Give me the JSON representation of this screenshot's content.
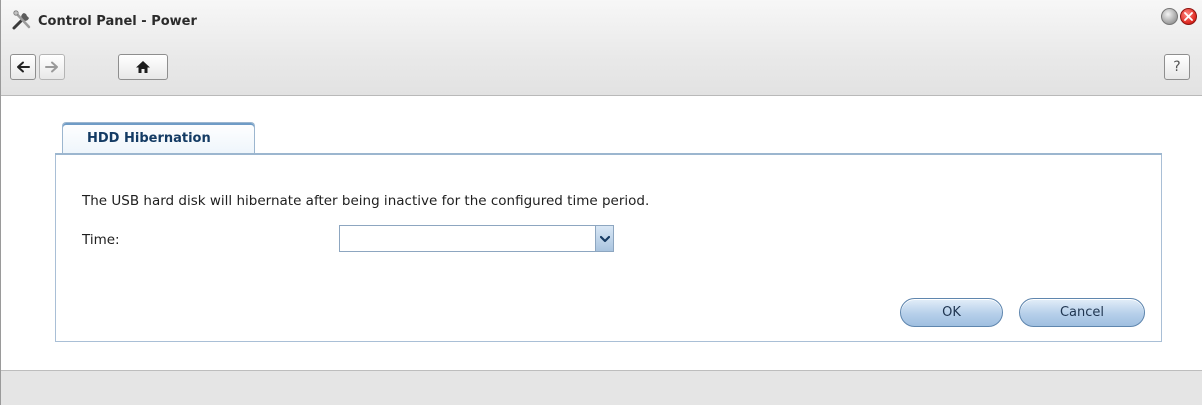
{
  "window": {
    "title": "Control Panel - Power",
    "app_icon": "tools-icon"
  },
  "toolbar": {
    "back_icon": "arrow-left-icon",
    "forward_icon": "arrow-right-icon",
    "home_icon": "home-icon",
    "help_label": "?"
  },
  "tabs": [
    {
      "label": "HDD Hibernation",
      "active": true
    }
  ],
  "form": {
    "description": "The USB hard disk will hibernate after being inactive for the configured time period.",
    "time_label": "Time:",
    "time_value": ""
  },
  "buttons": {
    "ok_label": "OK",
    "cancel_label": "Cancel"
  },
  "colors": {
    "accent": "#6f9cc6",
    "close_button": "#e02b23",
    "button_fill": "#b6cfea"
  }
}
